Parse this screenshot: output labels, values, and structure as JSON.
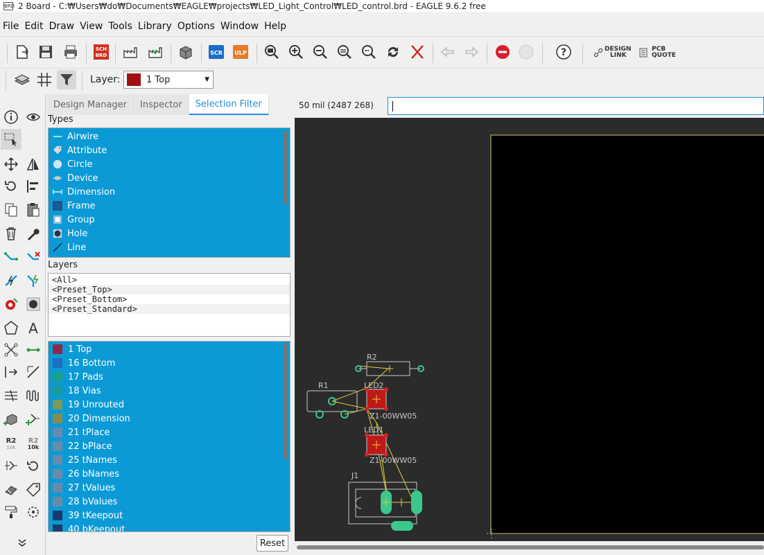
{
  "window": {
    "app_icon_text": "BRD",
    "title": "2 Board - C:₩Users₩do₩Documents₩EAGLE₩projects₩LED_Light_Control₩LED_control.brd - EAGLE 9.6.2 free"
  },
  "menu": [
    "File",
    "Edit",
    "Draw",
    "View",
    "Tools",
    "Library",
    "Options",
    "Window",
    "Help"
  ],
  "toolbar": {
    "sch_brd": [
      "SCH",
      "BRD"
    ],
    "scr": "SCR",
    "ulp": "ULP",
    "design_link": [
      "DESIGN",
      "LINK"
    ],
    "pcb_quote": [
      "PCB",
      "QUOTE"
    ]
  },
  "layer_bar": {
    "label": "Layer:",
    "selected": "1 Top",
    "selected_color": "#a01010"
  },
  "tabs": [
    {
      "label": "Design Manager",
      "active": false
    },
    {
      "label": "Inspector",
      "active": false
    },
    {
      "label": "Selection Filter",
      "active": true
    }
  ],
  "types_section": {
    "title": "Types",
    "items": [
      {
        "label": "Airwire",
        "icon": "airwire-icon"
      },
      {
        "label": "Attribute",
        "icon": "tag-icon"
      },
      {
        "label": "Circle",
        "icon": "circle-icon"
      },
      {
        "label": "Device",
        "icon": "device-icon"
      },
      {
        "label": "Dimension",
        "icon": "dimension-icon"
      },
      {
        "label": "Frame",
        "icon": "frame-icon"
      },
      {
        "label": "Group",
        "icon": "group-icon"
      },
      {
        "label": "Hole",
        "icon": "hole-icon"
      },
      {
        "label": "Line",
        "icon": "line-icon"
      }
    ]
  },
  "layers_section": {
    "title": "Layers",
    "presets": [
      "<All>",
      "<Preset_Top>",
      "<Preset_Bottom>",
      "<Preset_Standard>"
    ],
    "items": [
      {
        "label": "1 Top",
        "color": "#8a2a4a"
      },
      {
        "label": "16 Bottom",
        "color": "#1a70c0"
      },
      {
        "label": "17 Pads",
        "color": "#1aa08a"
      },
      {
        "label": "18 Vias",
        "color": "#1a9a9a"
      },
      {
        "label": "19 Unrouted",
        "color": "#7a9a5a"
      },
      {
        "label": "20 Dimension",
        "color": "#8a8a4a"
      },
      {
        "label": "21 tPlace",
        "color": "#6a8aaa"
      },
      {
        "label": "22 bPlace",
        "color": "#6a8aaa"
      },
      {
        "label": "25 tNames",
        "color": "#6a8aaa"
      },
      {
        "label": "26 bNames",
        "color": "#6a8aaa"
      },
      {
        "label": "27 tValues",
        "color": "#6a8aaa"
      },
      {
        "label": "28 bValues",
        "color": "#6a8aaa"
      },
      {
        "label": "39 tKeepout",
        "color": "#1a3a6a"
      },
      {
        "label": "40 bKeepout",
        "color": "#1a3a6a"
      }
    ]
  },
  "reset_label": "Reset",
  "status": {
    "grid_coords": "50 mil (2487 268)",
    "command_value": ""
  },
  "board": {
    "labels": {
      "r2": "R2",
      "r1": "R1",
      "led2": "LED2",
      "led1": "LED1",
      "led2_value": "Z1-00WW05",
      "led1_value": "Z1-00WW05",
      "j1": "J1"
    },
    "colors": {
      "canvas_bg": "#2b2b2b",
      "board_bg": "#000000",
      "outline": "#d4c070",
      "silk": "#c8c8c8",
      "pad_green": "#3cc88c",
      "pad_red": "#c01818",
      "airwire": "#e0d040"
    }
  }
}
